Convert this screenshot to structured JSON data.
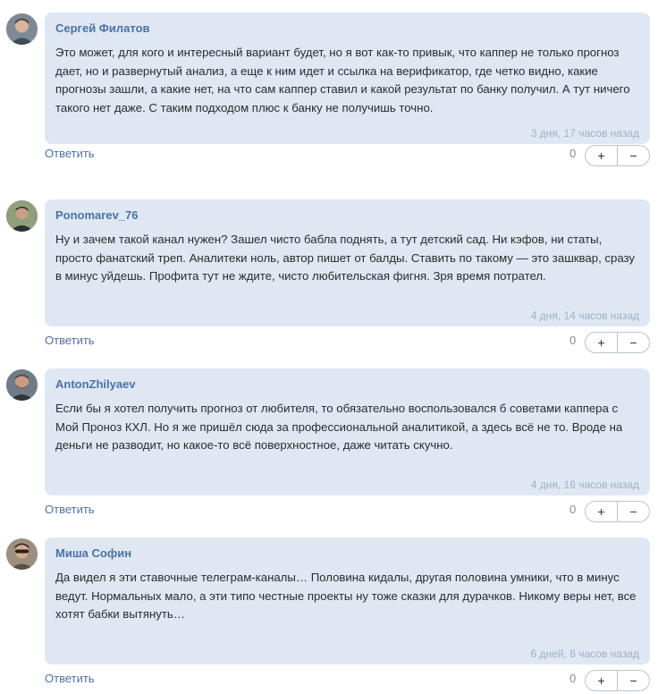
{
  "reply_label": "Ответить",
  "vote": {
    "plus": "+",
    "minus": "−"
  },
  "comments": [
    {
      "author": "Сергей Филатов",
      "avatar": "avatar-photo",
      "text": "Это может, для кого и интересный вариант будет, но я вот как-то привык, что каппер не только прогноз дает, но и развернутый анализ, а еще к ним идет и ссылка на верификатор, где четко видно, какие прогнозы зашли, а какие нет, на что сам каппер ставил и какой результат по банку получил. А тут ничего такого нет даже. С таким подходом плюс к банку не получишь точно.",
      "time": "3 дня, 17 часов назад",
      "score": "0"
    },
    {
      "author": "Ponomarev_76",
      "avatar": "avatar-photo",
      "text": "Ну и зачем такой канал нужен? Зашел чисто бабла поднять, а тут детский сад. Ни кэфов, ни статы, просто фанатский треп. Аналитеки ноль, автор пишет от балды. Ставить по такому — это зашквар, сразу в минус уйдешь. Профита тут не ждите, чисто любительская фигня. Зря время потрател.",
      "time": "4 дня, 14 часов назад",
      "score": "0"
    },
    {
      "author": "AntonZhilyaev",
      "avatar": "avatar-photo",
      "text": "Если бы я хотел получить прогноз от любителя, то обязательно воспользовался б советами каппера с Мой Проноз КХЛ. Но я же пришёл сюда за профессиональной аналитикой, а здесь всё не то. Вроде на деньги не разводит, но какое-то всё поверхностное, даже читать скучно.",
      "time": "4 дня, 16 часов назад",
      "score": "0"
    },
    {
      "author": "Миша Софин",
      "avatar": "avatar-photo",
      "text": "Да видел я эти ставочные телеграм-каналы… Половина кидалы, другая половина умники, что в минус ведут. Нормальных мало, а эти типо честные проекты ну тоже сказки для дурачков. Никому веры нет, все хотят бабки вытянуть…",
      "time": "6 дней, 8 часов назад",
      "score": "0"
    }
  ]
}
